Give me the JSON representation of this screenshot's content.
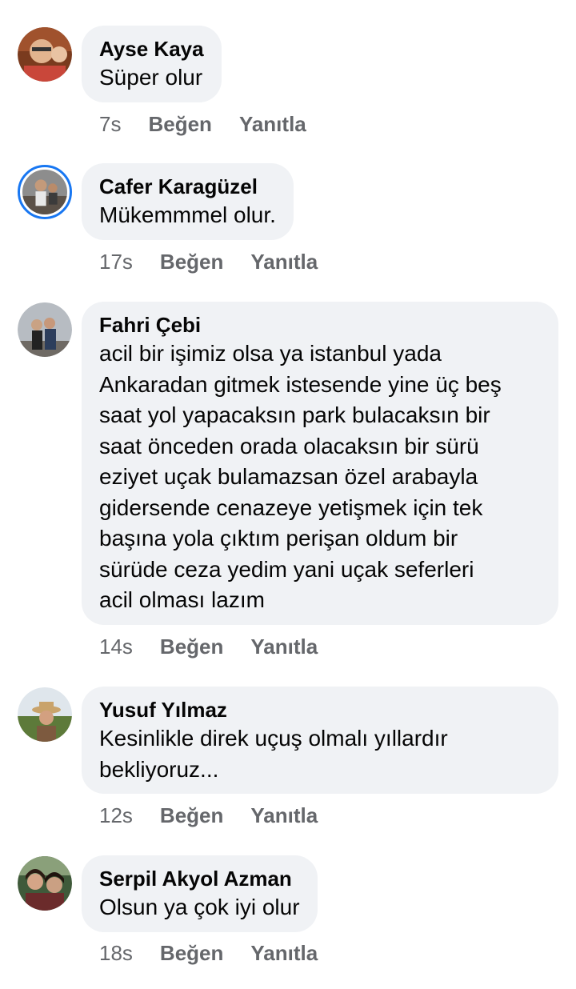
{
  "comments": [
    {
      "author": "Ayse Kaya",
      "text": "Süper olur",
      "time": "7s",
      "like_label": "Beğen",
      "reply_label": "Yanıtla"
    },
    {
      "author": "Cafer Karagüzel",
      "text": "Mükemmmel olur.",
      "time": "17s",
      "like_label": "Beğen",
      "reply_label": "Yanıtla"
    },
    {
      "author": "Fahri Çebi",
      "text": "acil bir işimiz olsa ya istanbul  yada\nAnkaradan gitmek istesende yine üç beş\nsaat yol yapacaksın park bulacaksın bir\nsaat önceden orada olacaksın bir sürü\neziyet uçak bulamazsan özel arabayla\ngidersende cenazeye yetişmek için tek\nbaşına yola çıktım perişan oldum bir\nsürüde ceza yedim yani uçak seferleri\nacil olması lazım",
      "time": "14s",
      "like_label": "Beğen",
      "reply_label": "Yanıtla"
    },
    {
      "author": "Yusuf Yılmaz",
      "text": "Kesinlikle direk uçuş olmalı yıllardır\nbekliyoruz...",
      "time": "12s",
      "like_label": "Beğen",
      "reply_label": "Yanıtla"
    },
    {
      "author": "Serpil Akyol Azman",
      "text": "Olsun ya çok iyi olur",
      "time": "18s",
      "like_label": "Beğen",
      "reply_label": "Yanıtla"
    }
  ],
  "colors": {
    "bubble": "#f0f2f5",
    "meta_text": "#65676b",
    "story_ring": "#1877f2"
  }
}
